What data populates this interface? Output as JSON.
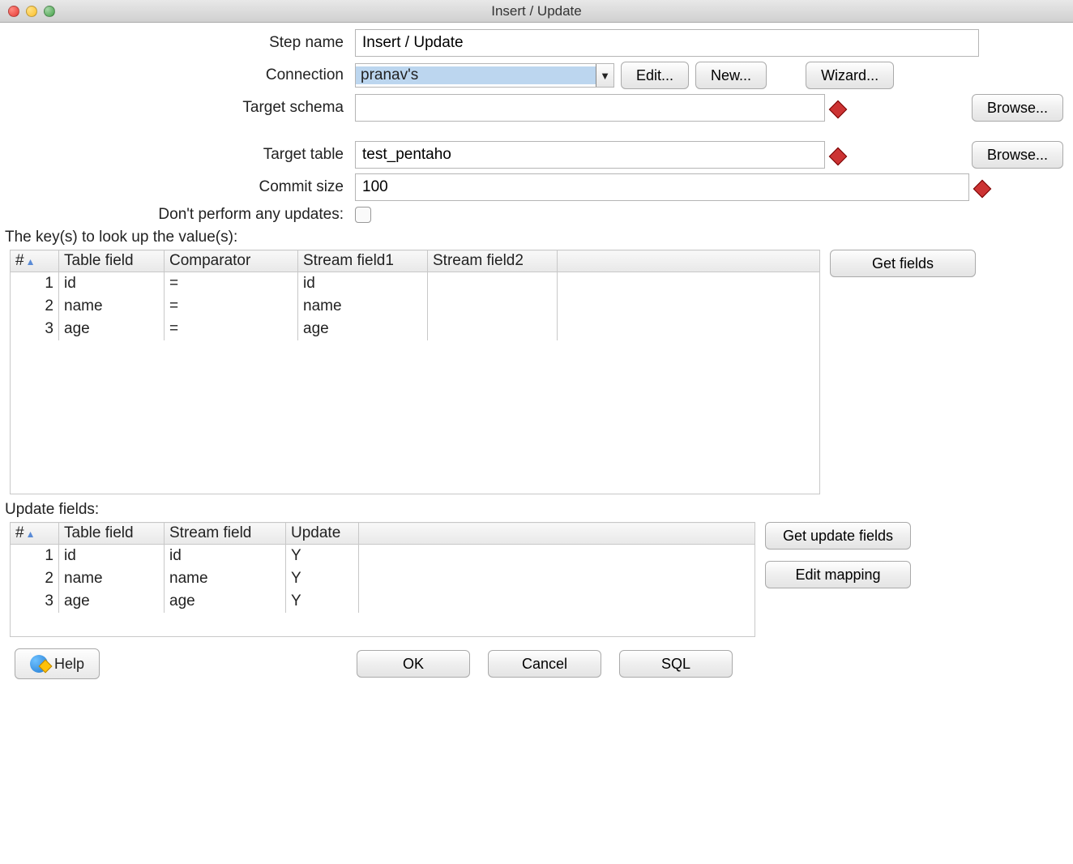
{
  "window": {
    "title": "Insert / Update"
  },
  "form": {
    "step_name_label": "Step name",
    "step_name_value": "Insert / Update",
    "connection_label": "Connection",
    "connection_value": "pranav's",
    "edit_btn": "Edit...",
    "new_btn": "New...",
    "wizard_btn": "Wizard...",
    "target_schema_label": "Target schema",
    "target_schema_value": "",
    "browse_btn": "Browse...",
    "target_table_label": "Target table",
    "target_table_value": "test_pentaho",
    "commit_size_label": "Commit size",
    "commit_size_value": "100",
    "dont_update_label": "Don't perform any updates:",
    "dont_update_checked": false
  },
  "keys": {
    "section_label": "The key(s) to look up the value(s):",
    "columns": {
      "num": "#",
      "table_field": "Table field",
      "comparator": "Comparator",
      "stream1": "Stream field1",
      "stream2": "Stream field2"
    },
    "rows": [
      {
        "n": "1",
        "table_field": "id",
        "comparator": "=",
        "stream1": "id",
        "stream2": ""
      },
      {
        "n": "2",
        "table_field": "name",
        "comparator": "=",
        "stream1": "name",
        "stream2": ""
      },
      {
        "n": "3",
        "table_field": "age",
        "comparator": "=",
        "stream1": "age",
        "stream2": ""
      }
    ],
    "get_fields_btn": "Get fields"
  },
  "updates": {
    "section_label": "Update fields:",
    "columns": {
      "num": "#",
      "table_field": "Table field",
      "stream_field": "Stream field",
      "update": "Update"
    },
    "rows": [
      {
        "n": "1",
        "table_field": "id",
        "stream_field": "id",
        "update": "Y"
      },
      {
        "n": "2",
        "table_field": "name",
        "stream_field": "name",
        "update": "Y"
      },
      {
        "n": "3",
        "table_field": "age",
        "stream_field": "age",
        "update": "Y"
      }
    ],
    "get_update_fields_btn": "Get update fields",
    "edit_mapping_btn": "Edit mapping"
  },
  "bottom": {
    "help": "Help",
    "ok": "OK",
    "cancel": "Cancel",
    "sql": "SQL"
  }
}
